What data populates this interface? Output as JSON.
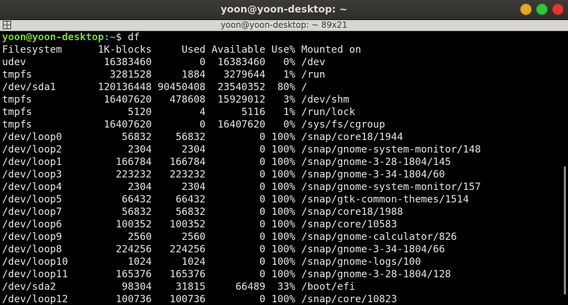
{
  "window": {
    "title": "yoon@yoon-desktop: ~",
    "tab_title": "yoon@yoon-desktop: ~ 89x21",
    "colors": {
      "close": "#e03a2c",
      "minimize": "#e3a72a",
      "maximize": "#35c23c",
      "prompt_user": "#7ed633",
      "prompt_path": "#6fa6e8"
    }
  },
  "terminal": {
    "prompt": {
      "user_host": "yoon@yoon-desktop",
      "path": ":~",
      "symbol": "$ ",
      "command": "df"
    },
    "lines": [
      "Filesystem      1K-blocks     Used Available Use% Mounted on",
      "udev             16383460        0  16383460   0% /dev",
      "tmpfs             3281528     1884   3279644   1% /run",
      "/dev/sda1       120136448 90450408  23540352  80% /",
      "tmpfs            16407620   478608  15929012   3% /dev/shm",
      "tmpfs                5120        4      5116   1% /run/lock",
      "tmpfs            16407620        0  16407620   0% /sys/fs/cgroup",
      "/dev/loop0          56832    56832         0 100% /snap/core18/1944",
      "/dev/loop2           2304     2304         0 100% /snap/gnome-system-monitor/148",
      "/dev/loop1         166784   166784         0 100% /snap/gnome-3-28-1804/145",
      "/dev/loop3         223232   223232         0 100% /snap/gnome-3-34-1804/60",
      "/dev/loop4           2304     2304         0 100% /snap/gnome-system-monitor/157",
      "/dev/loop5          66432    66432         0 100% /snap/gtk-common-themes/1514",
      "/dev/loop7          56832    56832         0 100% /snap/core18/1988",
      "/dev/loop6         100352   100352         0 100% /snap/core/10583",
      "/dev/loop9           2560     2560         0 100% /snap/gnome-calculator/826",
      "/dev/loop8         224256   224256         0 100% /snap/gnome-3-34-1804/66",
      "/dev/loop10          1024     1024         0 100% /snap/gnome-logs/100",
      "/dev/loop11        165376   165376         0 100% /snap/gnome-3-28-1804/128",
      "/dev/sda2           98304    31815     66489  33% /boot/efi",
      "/dev/loop12        100736   100736         0 100% /snap/core/10823"
    ]
  }
}
